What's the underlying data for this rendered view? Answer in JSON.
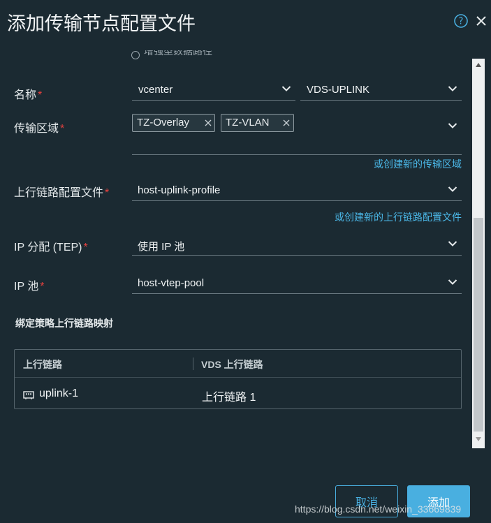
{
  "dialog": {
    "title": "添加传输节点配置文件",
    "partial_option": "增强型数据路径"
  },
  "form": {
    "name": {
      "label": "名称",
      "required": "*",
      "vcenter": "vcenter",
      "vds": "VDS-UPLINK"
    },
    "transport_zone": {
      "label": "传输区域",
      "required": "*",
      "tags": [
        "TZ-Overlay",
        "TZ-VLAN"
      ],
      "create_link": "或创建新的传输区域"
    },
    "uplink_profile": {
      "label": "上行链路配置文件",
      "required": "*",
      "value": "host-uplink-profile",
      "create_link": "或创建新的上行链路配置文件"
    },
    "ip_assignment": {
      "label": "IP 分配 (TEP)",
      "required": "*",
      "value": "使用 IP 池"
    },
    "ip_pool": {
      "label": "IP 池",
      "required": "*",
      "value": "host-vtep-pool"
    }
  },
  "mapping": {
    "section_title": "绑定策略上行链路映射",
    "columns": [
      "上行链路",
      "VDS 上行链路"
    ],
    "rows": [
      {
        "uplink": "uplink-1",
        "vds_uplink": "上行链路 1"
      }
    ]
  },
  "footer": {
    "cancel_label": "取消",
    "add_label": "添加"
  },
  "watermark": "https://blog.csdn.net/weixin_33669839",
  "colors": {
    "background": "#1b2a32",
    "accent": "#49afe0",
    "required": "#e8413e"
  },
  "icons": [
    "help-icon",
    "close-icon",
    "chevron-down-icon",
    "tag-remove-icon",
    "network-port-icon"
  ]
}
